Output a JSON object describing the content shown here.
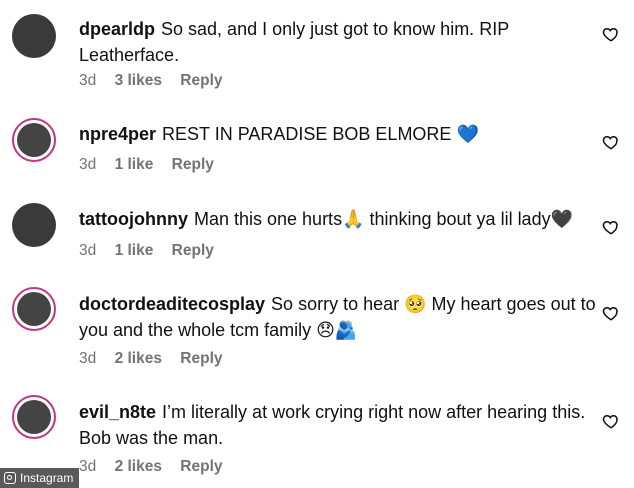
{
  "comments": [
    {
      "username": "dpearldp",
      "text": "So sad, and I only just got to know him. RIP Leatherface.",
      "age": "3d",
      "likes": "3 likes",
      "reply": "Reply",
      "story_ring": false
    },
    {
      "username": "npre4per",
      "text": "REST IN PARADISE BOB ELMORE 💙",
      "age": "3d",
      "likes": "1 like",
      "reply": "Reply",
      "story_ring": true
    },
    {
      "username": "tattoojohnny",
      "text": "Man this one hurts🙏 thinking bout ya lil lady🖤",
      "age": "3d",
      "likes": "1 like",
      "reply": "Reply",
      "story_ring": false
    },
    {
      "username": "doctordeaditecosplay",
      "text": "So sorry to hear 🥺 My heart goes out to you and the whole tcm family 😞🫂",
      "age": "3d",
      "likes": "2 likes",
      "reply": "Reply",
      "story_ring": true
    },
    {
      "username": "evil_n8te",
      "text": "I’m literally at work crying right now after hearing this. Bob was the man.",
      "age": "3d",
      "likes": "2 likes",
      "reply": "Reply",
      "story_ring": true
    }
  ],
  "watermark": "Instagram",
  "colors": {
    "ring": "#c13584",
    "meta": "#737373"
  },
  "icons": {
    "like": "heart-outline-icon"
  }
}
